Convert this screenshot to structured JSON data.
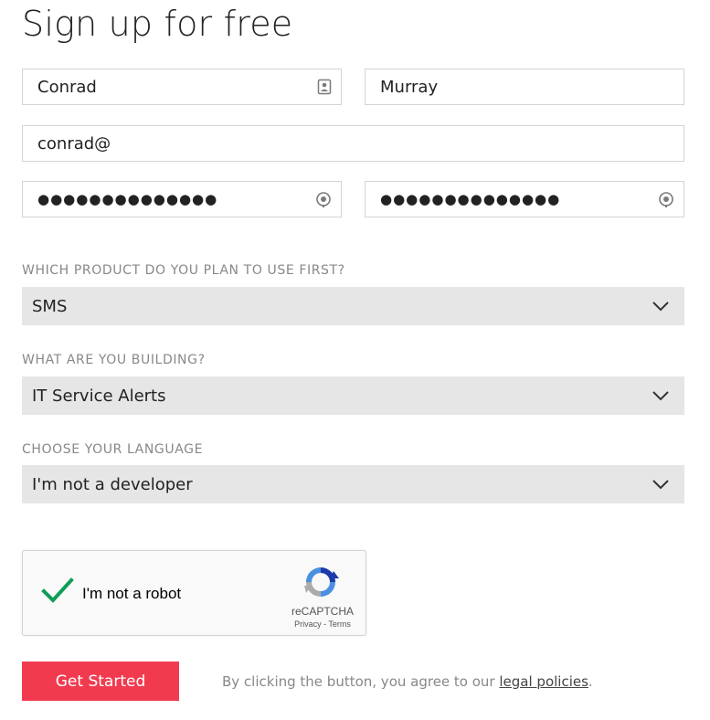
{
  "page": {
    "title": "Sign up for free"
  },
  "form": {
    "first_name": "Conrad",
    "last_name": "Murray",
    "email": "conrad@",
    "password": "●●●●●●●●●●●●●●",
    "confirm_password": "●●●●●●●●●●●●●●"
  },
  "product": {
    "label": "WHICH PRODUCT DO YOU PLAN TO USE FIRST?",
    "selected": "SMS"
  },
  "building": {
    "label": "WHAT ARE YOU BUILDING?",
    "selected": "IT Service Alerts"
  },
  "language": {
    "label": "CHOOSE YOUR LANGUAGE",
    "selected": "I'm not a developer"
  },
  "captcha": {
    "label": "I'm not a robot",
    "brand": "reCAPTCHA",
    "links": "Privacy - Terms"
  },
  "cta": {
    "button_label": "Get Started",
    "disclaimer_prefix": "By clicking the button, you agree to our ",
    "link_text": "legal policies",
    "disclaimer_suffix": "."
  },
  "colors": {
    "accent": "#f23a4f",
    "check": "#0f9d58",
    "select_bg": "#e6e6e6"
  },
  "icons": {
    "first_name": "contact-card-icon",
    "password": "password-reveal-icon",
    "select": "chevron-down-icon",
    "captcha_check": "checkmark-icon",
    "captcha_logo": "recaptcha-logo-icon"
  }
}
